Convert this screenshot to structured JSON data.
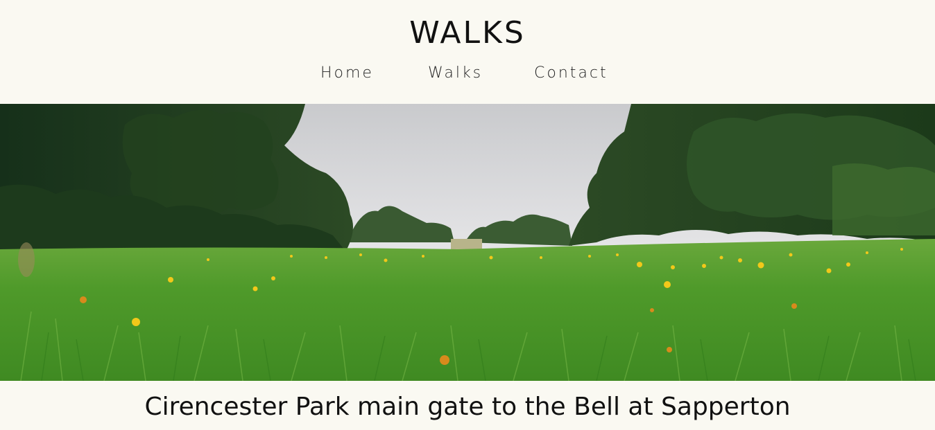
{
  "site": {
    "title": "WALKS"
  },
  "nav": {
    "items": [
      "Home",
      "Walks",
      "Contact"
    ]
  },
  "hero": {
    "image_description_icon": "meadow-photo"
  },
  "main": {
    "walk_title": "Cirencester Park main gate to the Bell at Sapperton"
  },
  "colors": {
    "background": "#faf9f2",
    "text": "#111111",
    "sky": "#d9dadc",
    "grass": "#4e9a2c",
    "trees": "#1f3a1a",
    "flowers": "#f1c40f"
  }
}
